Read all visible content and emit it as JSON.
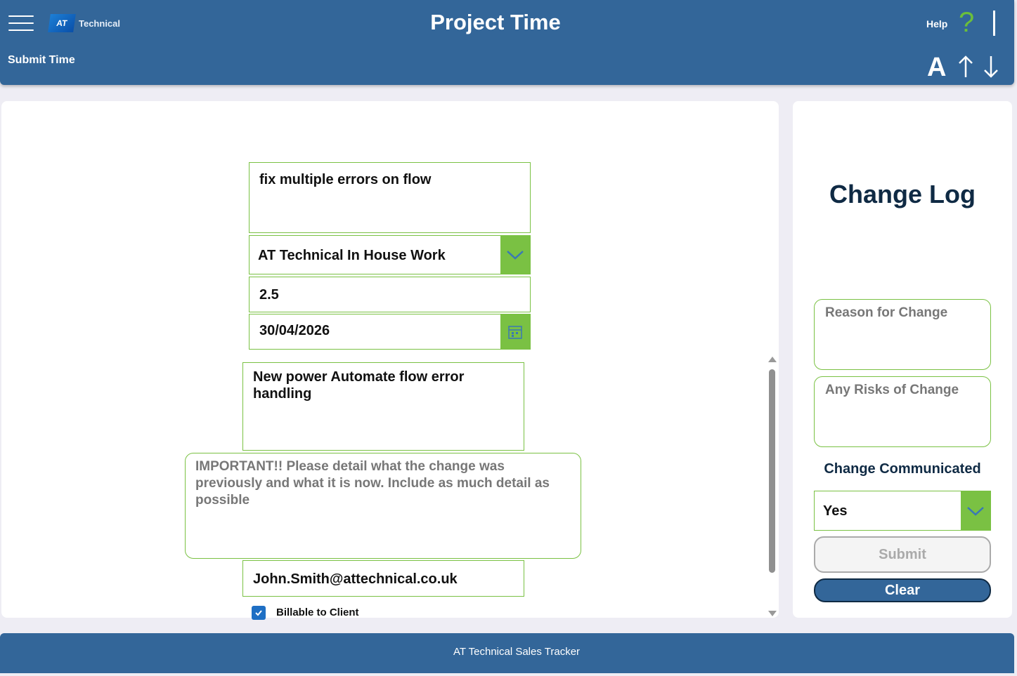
{
  "header": {
    "logo_mark": "AT",
    "logo_text": "Technical",
    "title": "Project Time",
    "nav_link": "Submit Time",
    "help_label": "Help",
    "help_icon": "question-mark-icon",
    "font_size_label": "A"
  },
  "form": {
    "task_description": "fix multiple errors on flow",
    "project": "AT Technical In House Work",
    "hours": "2.5",
    "date": "30/04/2026",
    "work_title": "New power Automate flow error handling",
    "change_detail_placeholder": "IMPORTANT!! Please detail what the change was previously and what it is now. Include as much detail as possible",
    "email": "John.Smith@attechnical.co.uk",
    "billable_label": "Billable to Client",
    "billable_checked": true
  },
  "change_log": {
    "title": "Change Log",
    "reason_placeholder": "Reason for Change",
    "risks_placeholder": "Any Risks of Change",
    "communicated_label": "Change Communicated",
    "communicated_value": "Yes",
    "submit_label": "Submit",
    "clear_label": "Clear"
  },
  "footer": {
    "text": "AT Technical Sales Tracker"
  },
  "colors": {
    "primary": "#336699",
    "accent_green": "#7ac143",
    "dark_navy": "#0f2a44",
    "checkbox_blue": "#1e6fc4"
  }
}
